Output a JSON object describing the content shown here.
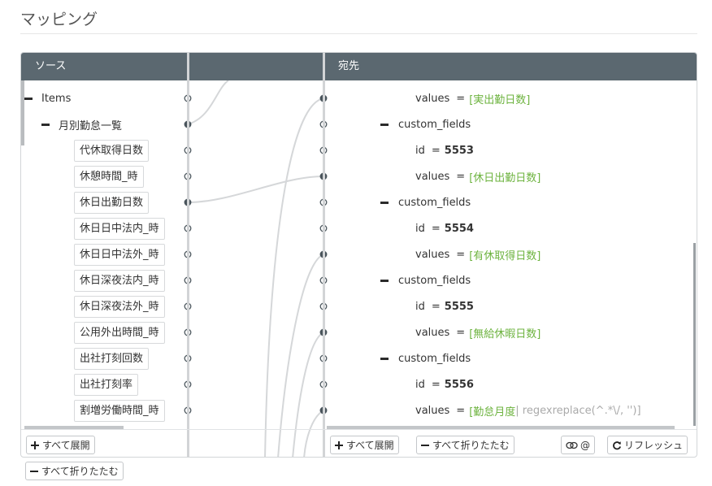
{
  "page": {
    "title": "マッピング"
  },
  "source": {
    "header": "ソース",
    "root": {
      "label": "Items"
    },
    "group": {
      "label": "月別勤怠一覧"
    },
    "fields": [
      {
        "label": "代休取得日数",
        "mapped": false
      },
      {
        "label": "休憩時間_時",
        "mapped": false
      },
      {
        "label": "休日出勤日数",
        "mapped": true
      },
      {
        "label": "休日日中法内_時",
        "mapped": false
      },
      {
        "label": "休日日中法外_時",
        "mapped": false
      },
      {
        "label": "休日深夜法内_時",
        "mapped": false
      },
      {
        "label": "休日深夜法外_時",
        "mapped": false
      },
      {
        "label": "公用外出時間_時",
        "mapped": false
      },
      {
        "label": "出社打刻回数",
        "mapped": false
      },
      {
        "label": "出社打刻率",
        "mapped": false
      },
      {
        "label": "割増労働時間_時",
        "mapped": false
      }
    ]
  },
  "destination": {
    "header": "宛先",
    "rows": [
      {
        "kind": "values",
        "key": "values",
        "value": "[実出勤日数]",
        "mapped": true
      },
      {
        "kind": "group",
        "key": "custom_fields",
        "mapped": false
      },
      {
        "kind": "id",
        "key": "id",
        "value": "5553",
        "mapped": false
      },
      {
        "kind": "values",
        "key": "values",
        "value": "[休日出勤日数]",
        "mapped": true
      },
      {
        "kind": "group",
        "key": "custom_fields",
        "mapped": false
      },
      {
        "kind": "id",
        "key": "id",
        "value": "5554",
        "mapped": false
      },
      {
        "kind": "values",
        "key": "values",
        "value": "[有休取得日数]",
        "mapped": true
      },
      {
        "kind": "group",
        "key": "custom_fields",
        "mapped": false
      },
      {
        "kind": "id",
        "key": "id",
        "value": "5555",
        "mapped": false
      },
      {
        "kind": "values",
        "key": "values",
        "value": "[無給休暇日数]",
        "mapped": true
      },
      {
        "kind": "group",
        "key": "custom_fields",
        "mapped": false
      },
      {
        "kind": "id",
        "key": "id",
        "value": "5556",
        "mapped": false
      },
      {
        "kind": "values",
        "key": "values",
        "value": "[勤怠月度",
        "suffix": " | regexreplace(^.*\\/, '')]",
        "mapped": true
      }
    ]
  },
  "toolbar": {
    "expand_all": "すべて展開",
    "collapse_all": "すべて折りたたむ",
    "link_toggle": "@",
    "refresh": "リフレッシュ"
  },
  "colors": {
    "header_bg": "#5b6870",
    "value_green": "#6db33f",
    "wire": "#d5d7d9"
  }
}
